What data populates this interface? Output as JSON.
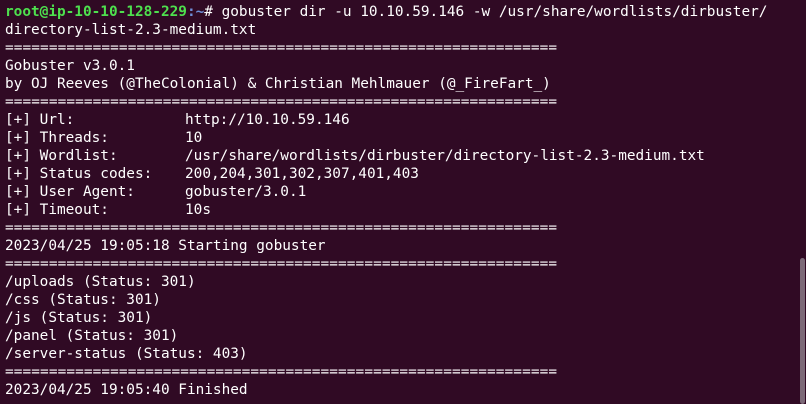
{
  "prompt": {
    "user_host": "root@ip-10-10-128-229",
    "path": ":~",
    "symbol": "# ",
    "command_part1": "gobuster dir -u 10.10.59.146 -w /usr/share/wordlists/dirbuster/",
    "command_part2": "directory-list-2.3-medium.txt"
  },
  "separator": "===============================================================",
  "banner": {
    "title": "Gobuster v3.0.1",
    "authors": "by OJ Reeves (@TheColonial) & Christian Mehlmauer (@_FireFart_)"
  },
  "config": [
    {
      "key": "[+] Url:",
      "value": "http://10.10.59.146"
    },
    {
      "key": "[+] Threads:",
      "value": "10"
    },
    {
      "key": "[+] Wordlist:",
      "value": "/usr/share/wordlists/dirbuster/directory-list-2.3-medium.txt"
    },
    {
      "key": "[+] Status codes:",
      "value": "200,204,301,302,307,401,403"
    },
    {
      "key": "[+] User Agent:",
      "value": "gobuster/3.0.1"
    },
    {
      "key": "[+] Timeout:",
      "value": "10s"
    }
  ],
  "start_line": "2023/04/25 19:05:18 Starting gobuster",
  "results": [
    "/uploads (Status: 301)",
    "/css (Status: 301)",
    "/js (Status: 301)",
    "/panel (Status: 301)",
    "/server-status (Status: 403)"
  ],
  "finish_line": "2023/04/25 19:05:40 Finished",
  "colors": {
    "background": "#300a24",
    "foreground": "#ffffff",
    "prompt_user": "#4ee04e",
    "prompt_path": "#6f8fd8"
  }
}
